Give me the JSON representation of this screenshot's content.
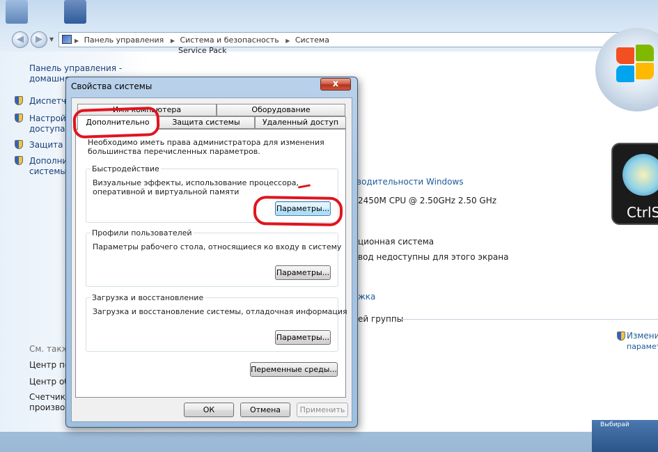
{
  "explorer": {
    "address": {
      "segments": [
        "Панель управления",
        "Система и безопасность",
        "Система"
      ]
    },
    "left_pane": {
      "home_link_line1": "Панель управления -",
      "home_link_line2": "домашняя",
      "tasks": [
        {
          "line1": "Диспетч",
          "line2": ""
        },
        {
          "line1": "Настройк",
          "line2": "доступа"
        },
        {
          "line1": "Защита с",
          "line2": ""
        },
        {
          "line1": "Дополнит",
          "line2": "системы"
        }
      ],
      "see_also": "См. также",
      "see_also_links": [
        "Центр по",
        "Центр об",
        "Счетчик",
        "производ"
      ]
    },
    "main": {
      "cut_top": "Service Pack",
      "perf_link": "водительности Windows",
      "cpu": "2450M CPU @ 2.50GHz   2.50 GHz",
      "os_type": "ционная система",
      "pen": "вод недоступны для этого экрана",
      "support_link": "жка",
      "workgroup": "ей группы",
      "change_link_line1": "Измени",
      "change_link_line2": "парамет",
      "ctrls_logo": "CtrlS",
      "taskbar_cut": "Выбирай"
    }
  },
  "dialog": {
    "title": "Свойства системы",
    "close": "x",
    "tabs_back": [
      "Имя компьютера",
      "Оборудование"
    ],
    "tabs_front": [
      "Дополнительно",
      "Защита системы",
      "Удаленный доступ"
    ],
    "admin_note": "Необходимо иметь права администратора для изменения большинства перечисленных параметров.",
    "groups": [
      {
        "title": "Быстродействие",
        "text": "Визуальные эффекты, использование процессора, оперативной и виртуальной памяти",
        "button": "Параметры..."
      },
      {
        "title": "Профили пользователей",
        "text": "Параметры рабочего стола, относящиеся ко входу в систему",
        "button": "Параметры..."
      },
      {
        "title": "Загрузка и восстановление",
        "text": "Загрузка и восстановление системы, отладочная информация",
        "button": "Параметры..."
      }
    ],
    "env_button": "Переменные среды...",
    "ok": "ОК",
    "cancel": "Отмена",
    "apply": "Применить"
  },
  "colors": {
    "annotation_red": "#e0141e",
    "link_blue": "#1a5c99"
  }
}
